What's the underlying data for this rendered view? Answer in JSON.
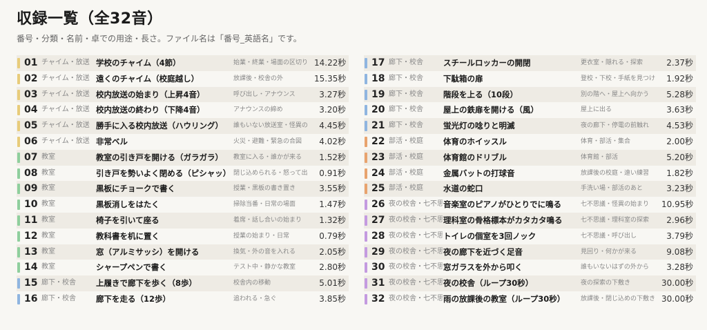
{
  "header": {
    "title": "収録一覧（全32音）",
    "subtitle": "番号・分類・名前・卓での用途・長さ。ファイル名は「番号_英語名」です。"
  },
  "colors": {
    "chime": "#e8cc7a",
    "classroom": "#8fcf9d",
    "hallway": "#8fb5e0",
    "club": "#e8a36e",
    "night": "#c49be0"
  },
  "tracks": [
    {
      "no": "01",
      "cat": "チャイム・放送",
      "group": "chime",
      "name": "学校のチャイム（4節）",
      "use": "始業・終業・場面の区切り",
      "len": "14.22秒"
    },
    {
      "no": "02",
      "cat": "チャイム・放送",
      "group": "chime",
      "name": "遠くのチャイム（校庭越し）",
      "use": "放課後・校舎の外",
      "len": "15.35秒"
    },
    {
      "no": "03",
      "cat": "チャイム・放送",
      "group": "chime",
      "name": "校内放送の始まり（上昇4音）",
      "use": "呼び出し・アナウンス",
      "len": "3.27秒"
    },
    {
      "no": "04",
      "cat": "チャイム・放送",
      "group": "chime",
      "name": "校内放送の終わり（下降4音）",
      "use": "アナウンスの締め",
      "len": "3.20秒"
    },
    {
      "no": "05",
      "cat": "チャイム・放送",
      "group": "chime",
      "name": "勝手に入る校内放送（ハウリング）",
      "use": "誰もいない放送室・怪異の",
      "len": "4.45秒"
    },
    {
      "no": "06",
      "cat": "チャイム・放送",
      "group": "chime",
      "name": "非常ベル",
      "use": "火災・避難・緊急の合図",
      "len": "4.02秒"
    },
    {
      "no": "07",
      "cat": "教室",
      "group": "classroom",
      "name": "教室の引き戸を開ける（ガラガラ）",
      "use": "教室に入る・誰かが来る",
      "len": "1.52秒"
    },
    {
      "no": "08",
      "cat": "教室",
      "group": "classroom",
      "name": "引き戸を勢いよく閉める（ピシャッ）",
      "use": "閉じ込められる・怒って出",
      "len": "0.91秒"
    },
    {
      "no": "09",
      "cat": "教室",
      "group": "classroom",
      "name": "黒板にチョークで書く",
      "use": "授業・黒板の書き置き",
      "len": "3.55秒"
    },
    {
      "no": "10",
      "cat": "教室",
      "group": "classroom",
      "name": "黒板消しをはたく",
      "use": "掃除当番・日常の場面",
      "len": "1.47秒"
    },
    {
      "no": "11",
      "cat": "教室",
      "group": "classroom",
      "name": "椅子を引いて座る",
      "use": "着席・話し合いの始まり",
      "len": "1.32秒"
    },
    {
      "no": "12",
      "cat": "教室",
      "group": "classroom",
      "name": "教科書を机に置く",
      "use": "授業の始まり・日常",
      "len": "0.79秒"
    },
    {
      "no": "13",
      "cat": "教室",
      "group": "classroom",
      "name": "窓（アルミサッシ）を開ける",
      "use": "換気・外の音を入れる",
      "len": "2.05秒"
    },
    {
      "no": "14",
      "cat": "教室",
      "group": "classroom",
      "name": "シャープペンで書く",
      "use": "テスト中・静かな教室",
      "len": "2.80秒"
    },
    {
      "no": "15",
      "cat": "廊下・校舎",
      "group": "hallway",
      "name": "上履きで廊下を歩く（8歩）",
      "use": "校舎内の移動",
      "len": "5.01秒"
    },
    {
      "no": "16",
      "cat": "廊下・校舎",
      "group": "hallway",
      "name": "廊下を走る（12歩）",
      "use": "追われる・急ぐ",
      "len": "3.85秒"
    },
    {
      "no": "17",
      "cat": "廊下・校舎",
      "group": "hallway",
      "name": "スチールロッカーの開閉",
      "use": "更衣室・隠れる・探索",
      "len": "2.37秒"
    },
    {
      "no": "18",
      "cat": "廊下・校舎",
      "group": "hallway",
      "name": "下駄箱の扉",
      "use": "登校・下校・手紙を見つけ",
      "len": "1.92秒"
    },
    {
      "no": "19",
      "cat": "廊下・校舎",
      "group": "hallway",
      "name": "階段を上る（10段）",
      "use": "別の階へ・屋上へ向かう",
      "len": "5.28秒"
    },
    {
      "no": "20",
      "cat": "廊下・校舎",
      "group": "hallway",
      "name": "屋上の鉄扉を開ける（風）",
      "use": "屋上に出る",
      "len": "3.63秒"
    },
    {
      "no": "21",
      "cat": "廊下・校舎",
      "group": "hallway",
      "name": "蛍光灯の唸りと明滅",
      "use": "夜の廊下・停電の前触れ",
      "len": "4.53秒"
    },
    {
      "no": "22",
      "cat": "部活・校庭",
      "group": "club",
      "name": "体育のホイッスル",
      "use": "体育・部活・集合",
      "len": "2.00秒"
    },
    {
      "no": "23",
      "cat": "部活・校庭",
      "group": "club",
      "name": "体育館のドリブル",
      "use": "体育館・部活",
      "len": "5.20秒"
    },
    {
      "no": "24",
      "cat": "部活・校庭",
      "group": "club",
      "name": "金属バットの打球音",
      "use": "放課後の校庭・遠い練習",
      "len": "1.82秒"
    },
    {
      "no": "25",
      "cat": "部活・校庭",
      "group": "club",
      "name": "水道の蛇口",
      "use": "手洗い場・部活のあと",
      "len": "3.23秒"
    },
    {
      "no": "26",
      "cat": "夜の校舎・七不思",
      "group": "night",
      "name": "音楽室のピアノがひとりでに鳴る",
      "use": "七不思議・怪異の始まり",
      "len": "10.95秒"
    },
    {
      "no": "27",
      "cat": "夜の校舎・七不思",
      "group": "night",
      "name": "理科室の骨格標本がカタカタ鳴る",
      "use": "七不思議・理科室の探索",
      "len": "2.96秒"
    },
    {
      "no": "28",
      "cat": "夜の校舎・七不思",
      "group": "night",
      "name": "トイレの個室を3回ノック",
      "use": "七不思議・呼び出し",
      "len": "3.79秒"
    },
    {
      "no": "29",
      "cat": "夜の校舎・七不思",
      "group": "night",
      "name": "夜の廊下を近づく足音",
      "use": "見回り・何かが来る",
      "len": "9.08秒"
    },
    {
      "no": "30",
      "cat": "夜の校舎・七不思",
      "group": "night",
      "name": "窓ガラスを外から叩く",
      "use": "誰もいないはずの外から",
      "len": "3.28秒"
    },
    {
      "no": "31",
      "cat": "夜の校舎・七不思",
      "group": "night",
      "name": "夜の校舎（ループ30秒）",
      "use": "夜の探索の下敷き",
      "len": "30.00秒"
    },
    {
      "no": "32",
      "cat": "夜の校舎・七不思",
      "group": "night",
      "name": "雨の放課後の教室（ループ30秒）",
      "use": "放課後・閉じ込めの下敷き",
      "len": "30.00秒"
    }
  ]
}
